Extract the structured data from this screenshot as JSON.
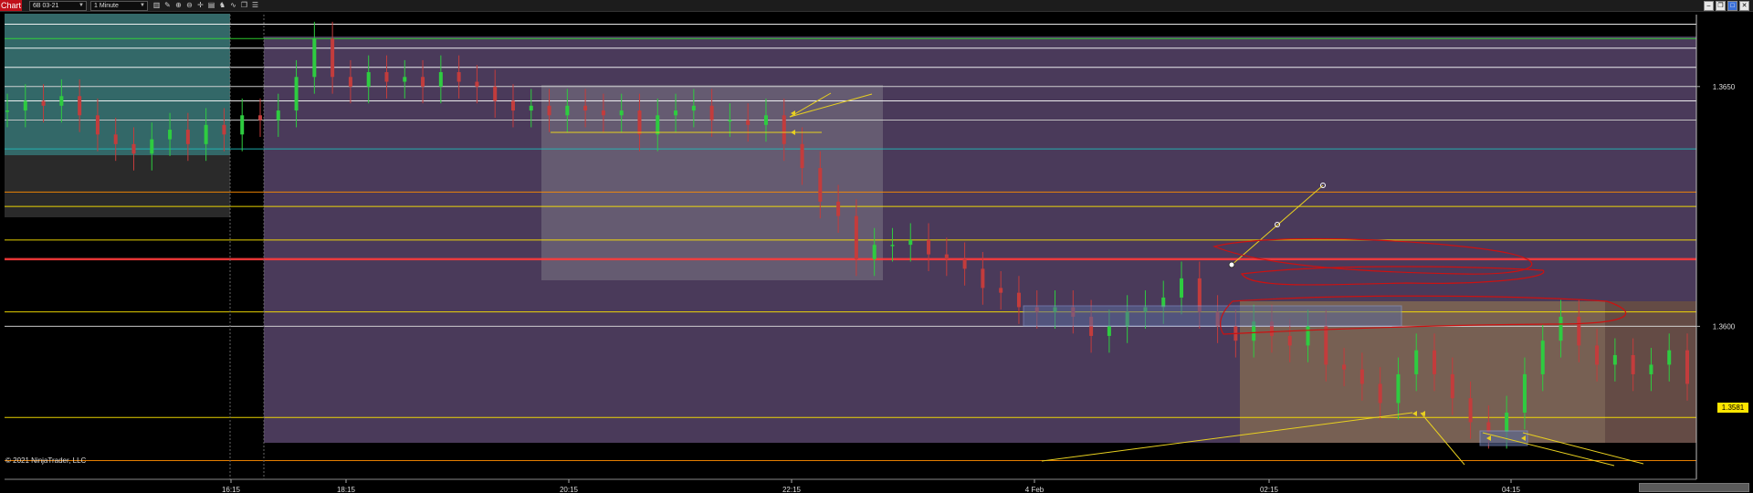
{
  "toolbar": {
    "tab_label": "Chart",
    "instrument": "6B 03-21",
    "interval": "1 Minute",
    "icons": [
      "bar-type-icon",
      "pencil-icon",
      "zoom-in-icon",
      "zoom-out-icon",
      "crosshair-icon",
      "properties-icon",
      "strategy-icon",
      "indicator-icon",
      "copy-icon",
      "data-box-icon"
    ],
    "window_icons": [
      "minimize-icon",
      "restore-icon",
      "maximize-icon",
      "close-icon"
    ]
  },
  "copyright": "© 2021 NinjaTrader, LLC",
  "price_badge": "1.3581",
  "chart_data": {
    "type": "candlestick",
    "x_tick_labels": [
      "16:15",
      "18:15",
      "20:15",
      "22:15",
      "4 Feb",
      "02:15",
      "04:15"
    ],
    "y_tick_labels": [
      "1.3650",
      "1.3600"
    ],
    "ylim": [
      1.357,
      1.3665
    ],
    "last_price": 1.3581,
    "colors": {
      "up_candle": "#2ecc40",
      "down_candle": "#c33c3c",
      "background": "#000000",
      "range_zone": "#4a3a5a",
      "session_zone": "#3c7a7a",
      "late_zone": "#8a7050",
      "supply_box": "#5a6a9a",
      "ray_lines": "#e8d020",
      "freehand": "#cc1111"
    },
    "horizontal_levels": [
      {
        "price": 1.3663,
        "color": "#ffffff"
      },
      {
        "price": 1.366,
        "color": "#33dd33"
      },
      {
        "price": 1.3658,
        "color": "#ffffff"
      },
      {
        "price": 1.3654,
        "color": "#ffffff"
      },
      {
        "price": 1.365,
        "color": "#dddddd"
      },
      {
        "price": 1.3647,
        "color": "#ffffff"
      },
      {
        "price": 1.3643,
        "color": "#cccccc"
      },
      {
        "price": 1.3637,
        "color": "#22bbbb"
      },
      {
        "price": 1.3628,
        "color": "#ff8c00"
      },
      {
        "price": 1.3625,
        "color": "#ffe600"
      },
      {
        "price": 1.3618,
        "color": "#ffe600"
      },
      {
        "price": 1.3614,
        "color": "#ff3b3b"
      },
      {
        "price": 1.3603,
        "color": "#ffe600"
      },
      {
        "price": 1.36,
        "color": "#dddddd"
      },
      {
        "price": 1.3581,
        "color": "#ffe600"
      },
      {
        "price": 1.3572,
        "color": "#ff8c00"
      }
    ],
    "path": [
      1.3645,
      1.3647,
      1.3646,
      1.3648,
      1.3644,
      1.364,
      1.3638,
      1.3636,
      1.3639,
      1.3641,
      1.3638,
      1.3642,
      1.364,
      1.3644,
      1.3643,
      1.3645,
      1.3652,
      1.366,
      1.3652,
      1.365,
      1.3653,
      1.3651,
      1.3652,
      1.365,
      1.3653,
      1.3651,
      1.365,
      1.3647,
      1.3645,
      1.3646,
      1.3644,
      1.3646,
      1.3645,
      1.3644,
      1.3645,
      1.364,
      1.3644,
      1.3645,
      1.3646,
      1.3643,
      1.3643,
      1.3642,
      1.3644,
      1.3638,
      1.3633,
      1.3626,
      1.3623,
      1.3614,
      1.3617,
      1.3617,
      1.3618,
      1.3615,
      1.3614,
      1.3612,
      1.3608,
      1.3607,
      1.3604,
      1.3603,
      1.3604,
      1.3602,
      1.3598,
      1.36,
      1.3603,
      1.3604,
      1.3606,
      1.361,
      1.3603,
      1.36,
      1.3597,
      1.3601,
      1.3598,
      1.3596,
      1.36,
      1.3592,
      1.3591,
      1.3588,
      1.3584,
      1.359,
      1.3595,
      1.359,
      1.3585,
      1.358,
      1.3578,
      1.3582,
      1.359,
      1.3597,
      1.3602,
      1.3596,
      1.3592,
      1.3594,
      1.359,
      1.3592,
      1.3595,
      1.3588
    ]
  }
}
